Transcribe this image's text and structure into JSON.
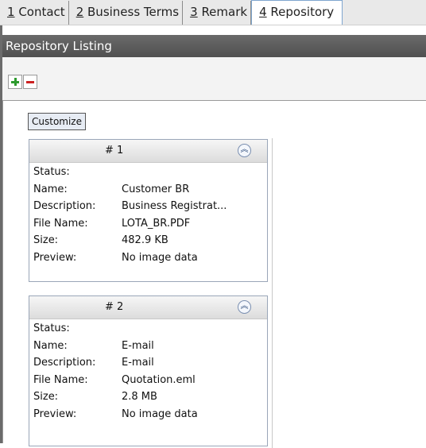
{
  "tabs": [
    {
      "key": "1",
      "label": "Contact"
    },
    {
      "key": "2",
      "label": "Business Terms"
    },
    {
      "key": "3",
      "label": "Remark"
    },
    {
      "key": "4",
      "label": "Repository"
    }
  ],
  "header": {
    "title": "Repository Listing"
  },
  "toolbar": {
    "add_icon": "plus-icon",
    "remove_icon": "minus-icon"
  },
  "listing": {
    "customize_label": "Customize",
    "collapse_icon": "chevron-double-up-icon"
  },
  "labels": {
    "status": "Status:",
    "name": "Name:",
    "description": "Description:",
    "file_name": "File Name:",
    "size": "Size:",
    "preview": "Preview:"
  },
  "cards": [
    {
      "title": "# 1",
      "status": "",
      "name": "Customer BR",
      "description": "Business Registrat...",
      "file_name": "LOTA_BR.PDF",
      "size": "482.9 KB",
      "preview": "No image data"
    },
    {
      "title": "# 2",
      "status": "",
      "name": "E-mail",
      "description": "E-mail",
      "file_name": "Quotation.eml",
      "size": "2.8 MB",
      "preview": "No image data"
    }
  ],
  "colors": {
    "accent": "#7fa6cf",
    "header_bg": "#5c5c5c",
    "add": "#2e9a2e",
    "remove": "#cc2222"
  }
}
